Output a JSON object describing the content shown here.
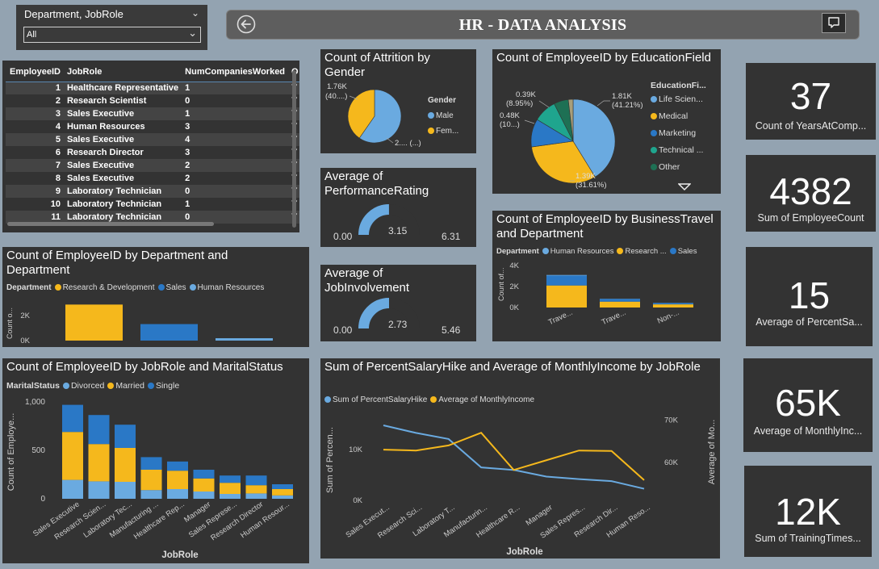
{
  "slicer": {
    "title": "Department, JobRole",
    "value": "All"
  },
  "header": {
    "title": "HR - DATA ANALYSIS",
    "back_icon": "back-arrow-icon",
    "comment_icon": "comment-icon"
  },
  "employee_table": {
    "columns": [
      "EmployeeID",
      "JobRole",
      "NumCompaniesWorked",
      "O"
    ],
    "rows": [
      [
        "1",
        "Healthcare Representative",
        "1",
        "Y"
      ],
      [
        "2",
        "Research Scientist",
        "0",
        "Y"
      ],
      [
        "3",
        "Sales Executive",
        "1",
        "Y"
      ],
      [
        "4",
        "Human Resources",
        "3",
        "Y"
      ],
      [
        "5",
        "Sales Executive",
        "4",
        "Y"
      ],
      [
        "6",
        "Research Director",
        "3",
        "Y"
      ],
      [
        "7",
        "Sales Executive",
        "2",
        "Y"
      ],
      [
        "8",
        "Sales Executive",
        "2",
        "Y"
      ],
      [
        "9",
        "Laboratory Technician",
        "0",
        "Y"
      ],
      [
        "10",
        "Laboratory Technician",
        "1",
        "Y"
      ],
      [
        "11",
        "Laboratory Technician",
        "0",
        "Y"
      ]
    ]
  },
  "kpis": [
    {
      "value": "37",
      "label": "Count of YearsAtComp..."
    },
    {
      "value": "4382",
      "label": "Sum of EmployeeCount"
    },
    {
      "value": "15",
      "label": "Average of PercentSa..."
    },
    {
      "value": "65K",
      "label": "Average of MonthlyInc..."
    },
    {
      "value": "12K",
      "label": "Sum of TrainingTimes..."
    }
  ],
  "colors": {
    "light_blue": "#6aaae0",
    "yellow": "#f5b81c",
    "dark_blue": "#2a78c6",
    "teal": "#1fa58e",
    "dark_green": "#1e7054",
    "tan": "#a89e7a"
  },
  "chart_data": [
    {
      "id": "attrition_gender",
      "type": "pie",
      "title": "Count of Attrition by Gender",
      "legend_title": "Gender",
      "labels": [
        "Male",
        "Fem..."
      ],
      "values": [
        2.6,
        1.76
      ],
      "data_labels": [
        "2.... (...)",
        "1.76K (40....)"
      ]
    },
    {
      "id": "education_field",
      "type": "pie",
      "title": "Count of EmployeeID by EducationField",
      "legend_title": "EducationFi...",
      "labels": [
        "Life Scien...",
        "Medical",
        "Marketing",
        "Technical ...",
        "Other"
      ],
      "values": [
        41.21,
        31.61,
        10.8,
        8.95,
        5.6,
        1.83
      ],
      "data_labels": [
        "1.81K (41.21%)",
        "1.39K (31.61%)",
        "0.48K (10...)",
        "0.39K (8.95%)"
      ]
    },
    {
      "id": "performance_rating",
      "type": "gauge",
      "title": "Average of PerformanceRating",
      "min": 0,
      "max": 6.31,
      "value": 3.15,
      "labels": {
        "min": "0.00",
        "value": "3.15",
        "max": "6.31"
      }
    },
    {
      "id": "job_involvement",
      "type": "gauge",
      "title": "Average of JobInvolvement",
      "min": 0,
      "max": 5.46,
      "value": 2.73,
      "labels": {
        "min": "0.00",
        "value": "2.73",
        "max": "5.46"
      }
    },
    {
      "id": "business_travel",
      "type": "bar",
      "stacked": true,
      "title": "Count of EmployeeID by BusinessTravel and Department",
      "legend_title": "Department",
      "categories": [
        "Trave...",
        "Trave...",
        "Non-..."
      ],
      "series": [
        {
          "name": "Human Resources",
          "values": [
            60,
            20,
            10
          ]
        },
        {
          "name": "Research ...",
          "values": [
            2100,
            560,
            300
          ]
        },
        {
          "name": "Sales",
          "values": [
            940,
            250,
            130
          ]
        }
      ],
      "ylabel": "Count of...",
      "yticks": [
        "0K",
        "2K",
        "4K"
      ],
      "ylim": [
        0,
        4400
      ]
    },
    {
      "id": "department",
      "type": "bar",
      "title": "Count of EmployeeID by Department and Department",
      "legend_title": "Department",
      "categories": [
        "Research & Development",
        "Sales",
        "Human Resources"
      ],
      "series": [
        {
          "name": "Research & Development",
          "values": [
            2880
          ]
        },
        {
          "name": "Sales",
          "values": [
            1320
          ]
        },
        {
          "name": "Human Resources",
          "values": [
            190
          ]
        }
      ],
      "ylabel": "Count o...",
      "yticks": [
        "0K",
        "2K"
      ],
      "ylim": [
        0,
        3300
      ]
    },
    {
      "id": "jobrole_marital",
      "type": "bar",
      "stacked": true,
      "title": "Count of EmployeeID by JobRole and MaritalStatus",
      "legend_title": "MaritalStatus",
      "categories": [
        "Sales Executive",
        "Research Scien...",
        "Laboratory Tec...",
        "Manufacturing ...",
        "Healthcare Rep...",
        "Manager",
        "Sales Represe...",
        "Research Director",
        "Human Resour..."
      ],
      "series": [
        {
          "name": "Divorced",
          "values": [
            195,
            180,
            175,
            90,
            100,
            75,
            50,
            55,
            35
          ]
        },
        {
          "name": "Married",
          "values": [
            495,
            385,
            350,
            210,
            190,
            135,
            115,
            85,
            65
          ]
        },
        {
          "name": "Single",
          "values": [
            280,
            300,
            240,
            130,
            95,
            90,
            75,
            100,
            50
          ]
        }
      ],
      "xlabel": "JobRole",
      "ylabel": "Count of Employe...",
      "yticks": [
        "0",
        "500",
        "1,000"
      ],
      "ylim": [
        0,
        1000
      ]
    },
    {
      "id": "salary_income",
      "type": "line",
      "title": "Sum of PercentSalaryHike and Average of MonthlyIncome by JobRole",
      "categories": [
        "Sales Execut...",
        "Research Sci...",
        "Laboratory T...",
        "Manufacturin...",
        "Healthcare R...",
        "Manager",
        "Sales Repres...",
        "Research Dir...",
        "Human Reso..."
      ],
      "series": [
        {
          "name": "Sum of PercentSalaryHike",
          "axis": "left",
          "values": [
            14800,
            13300,
            12100,
            6500,
            6000,
            4700,
            4200,
            3800,
            2300
          ]
        },
        {
          "name": "Average of MonthlyIncome",
          "axis": "right",
          "values": [
            63000,
            62800,
            64000,
            67000,
            58200,
            60500,
            62800,
            62700,
            55800
          ]
        }
      ],
      "xlabel": "JobRole",
      "ylabel_left": "Sum of Percen...",
      "ylabel_right": "Average of Mo...",
      "left_ticks": [
        "0K",
        "10K"
      ],
      "left_ylim": [
        0,
        17500
      ],
      "right_ticks": [
        "60K",
        "70K"
      ],
      "right_ylim": [
        51000,
        72000
      ]
    }
  ]
}
